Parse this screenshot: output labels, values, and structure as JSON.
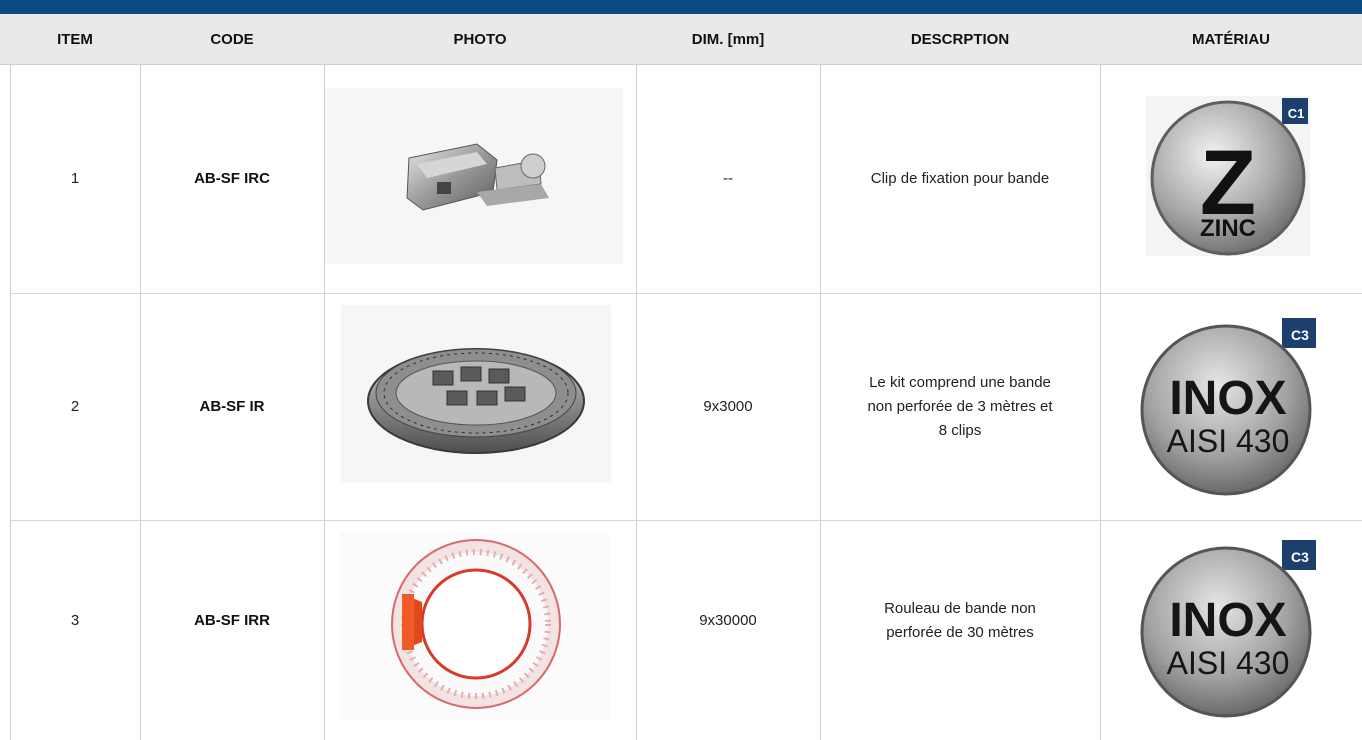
{
  "table": {
    "headers": {
      "item": "ITEM",
      "code": "CODE",
      "photo": "PHOTO",
      "dim": "DIM. [mm]",
      "description": "DESCRPTION",
      "material": "MATÉRIAU"
    },
    "rows": [
      {
        "item": "1",
        "code": "AB-SF IRC",
        "photo_icon": "clip-photo",
        "dim": "--",
        "description": "Clip de fixation pour bande",
        "material": {
          "class": "C1",
          "name": "ZINC",
          "letter": "Z"
        }
      },
      {
        "item": "2",
        "code": "AB-SF IR",
        "photo_icon": "kit-coil-photo",
        "dim": "9x3000",
        "description": "Le kit comprend une bande non perforée de 3 mètres et 8 clips",
        "material": {
          "class": "C3",
          "name": "INOX",
          "grade": "AISI 430"
        }
      },
      {
        "item": "3",
        "code": "AB-SF IRR",
        "photo_icon": "roll-photo",
        "dim": "9x30000",
        "description": "Rouleau de bande non perforée de 30 mètres",
        "material": {
          "class": "C3",
          "name": "INOX",
          "grade": "AISI 430"
        }
      }
    ]
  },
  "colors": {
    "header_bar": "#0e4a82",
    "header_bg": "#e9e9e9",
    "badge_corner": "#1d3f6e"
  }
}
